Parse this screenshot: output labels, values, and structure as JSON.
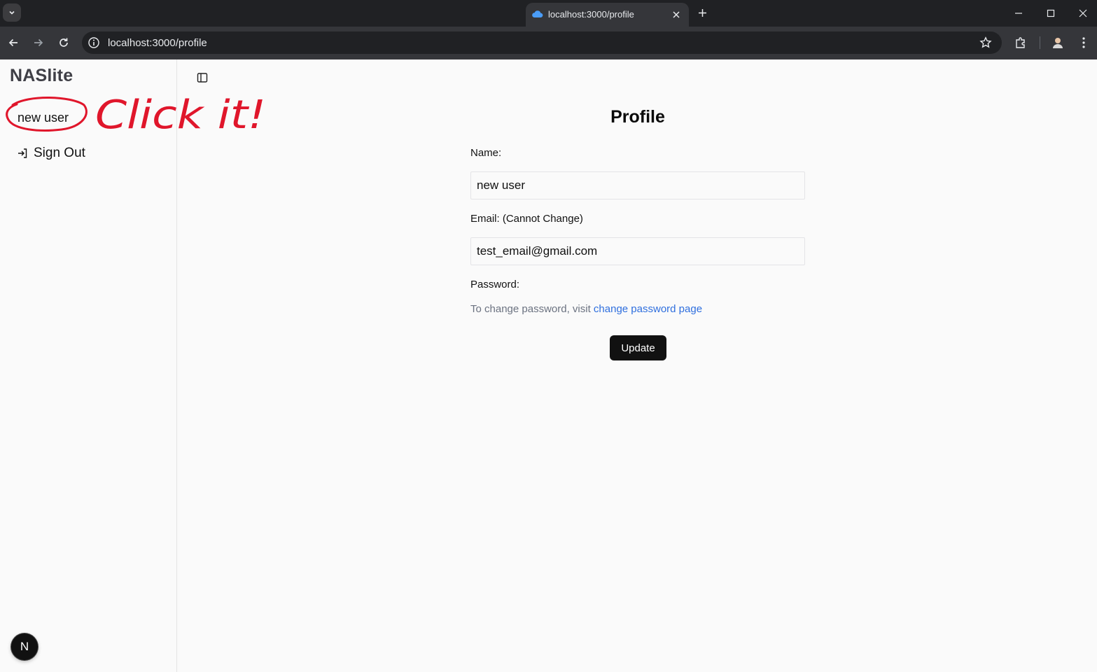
{
  "browser": {
    "tab_title": "localhost:3000/profile",
    "url": "localhost:3000/profile"
  },
  "sidebar": {
    "brand": "NASlite",
    "user_name": "new user",
    "sign_out": "Sign Out",
    "badge_letter": "N"
  },
  "annotation": {
    "text": "Click it!",
    "color": "#e0162b"
  },
  "profile": {
    "title": "Profile",
    "name_label": "Name:",
    "name_value": "new user",
    "email_label": "Email: (Cannot Change)",
    "email_value": "test_email@gmail.com",
    "password_label": "Password:",
    "password_note": "To change password, visit ",
    "password_link": "change password page",
    "update_button": "Update"
  },
  "colors": {
    "link": "#2f6fde",
    "button_bg": "#111111"
  }
}
